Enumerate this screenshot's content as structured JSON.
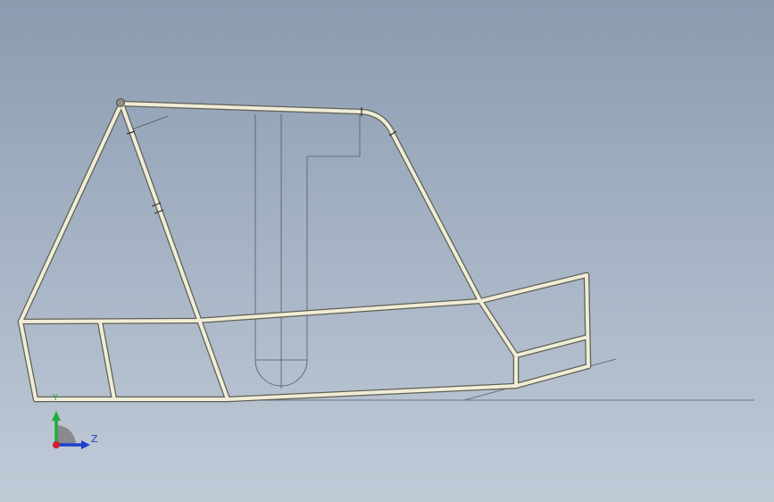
{
  "viewport": {
    "background_top": "#8b9bb0",
    "background_bottom": "#c1cad7"
  },
  "model": {
    "tube_color": "#efedd6",
    "tube_edge_color": "#5f5f55",
    "sketch_line_color": "#55595f"
  },
  "triad": {
    "y_axis_label": "Y",
    "z_axis_label": "Z",
    "y_color": "#1fae3a",
    "z_color": "#1d3fd0",
    "x_color": "#d0202a",
    "icon": "view-orientation-triad-icon"
  }
}
